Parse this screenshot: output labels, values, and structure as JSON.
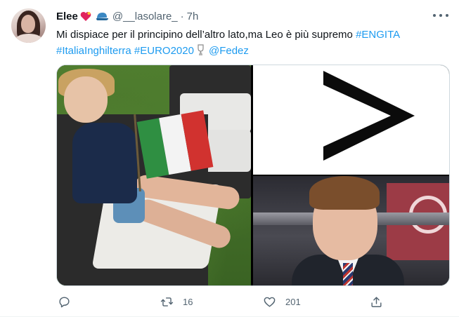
{
  "tweet": {
    "author": {
      "display_name": "Elee",
      "name_emojis": [
        "heart-emoji",
        "blue-cap-emoji"
      ],
      "handle": "@__lasolare_",
      "separator": "·",
      "time": "7h"
    },
    "text": {
      "line1_plain": "Mi dispiace per il principino dell’altro lato,ma Leo è più supremo ",
      "line1_tag": "#ENGITA",
      "line2_tag1": "#ItaliaInghilterra",
      "line2_tag2": "#EURO2020",
      "line2_emoji": "trophy-emoji",
      "line2_mention": "@Fedez"
    },
    "media": {
      "symbol": ">",
      "images": [
        "boy-with-italian-flag-photo",
        "greater-than-sign-image",
        "prince-george-stadium-photo"
      ]
    },
    "actions": {
      "reply_count": "",
      "retweet_count": "16",
      "like_count": "201"
    },
    "colors": {
      "link": "#1d9bf0",
      "secondary_text": "#536471",
      "primary_text": "#0f1419",
      "border": "#cfd9de"
    }
  }
}
